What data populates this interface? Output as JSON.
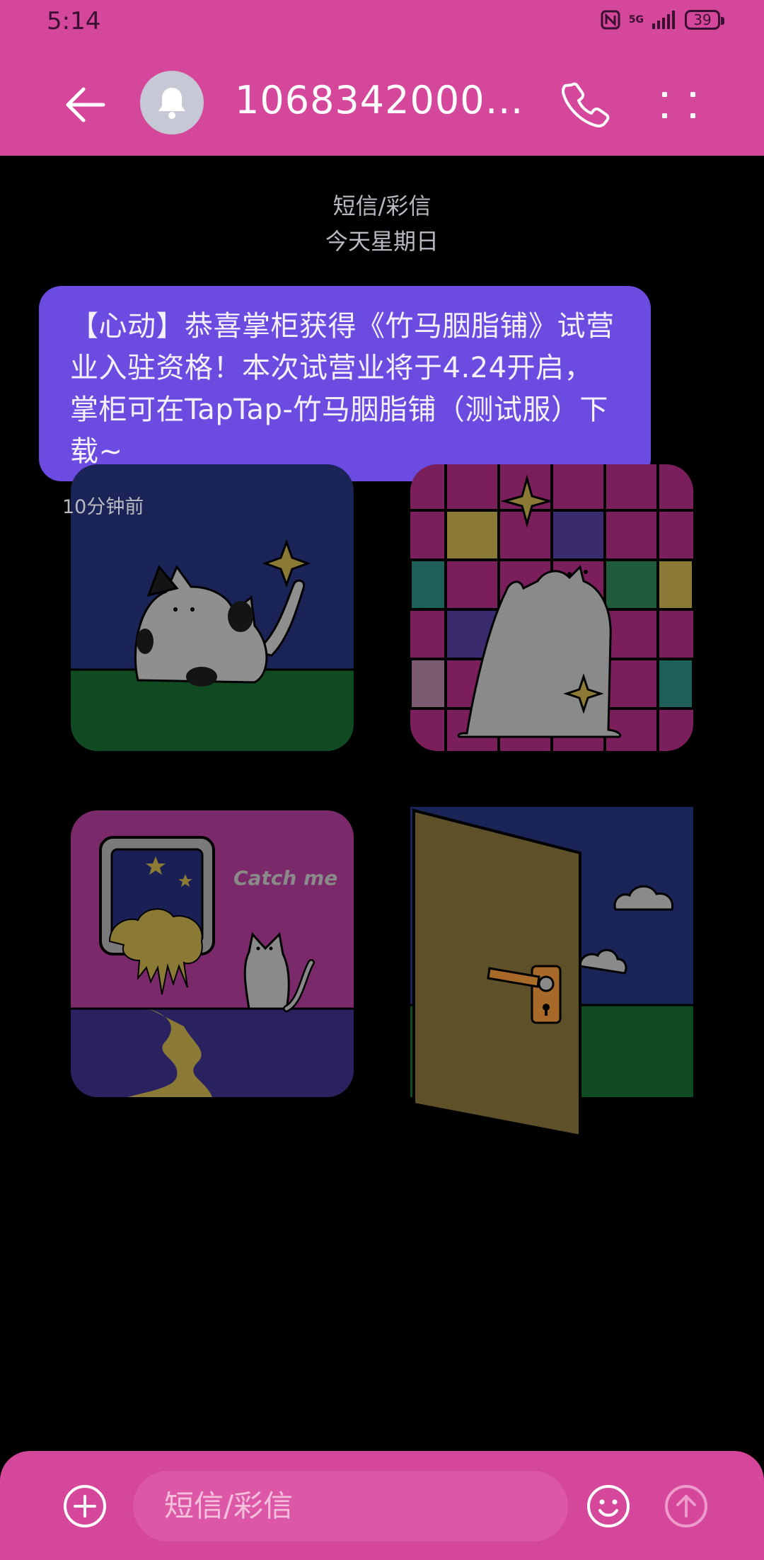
{
  "status_bar": {
    "time": "5:14",
    "network": "5G",
    "battery": "39"
  },
  "header": {
    "contact_name": "10683420009…"
  },
  "thread": {
    "type_label": "短信/彩信",
    "date_label": "今天星期日"
  },
  "message": {
    "text": "【心动】恭喜掌柜获得《竹马胭脂铺》试营业入驻资格！本次试营业将于4.24开启，掌柜可在TapTap-竹马胭脂铺（测试服）下载~",
    "time": "10分钟前"
  },
  "stickers": {
    "catch_me_text": "Catch me"
  },
  "composer": {
    "placeholder": "短信/彩信"
  },
  "colors": {
    "accent": "#d5479b",
    "bubble": "#6b4be0",
    "background": "#000000"
  }
}
